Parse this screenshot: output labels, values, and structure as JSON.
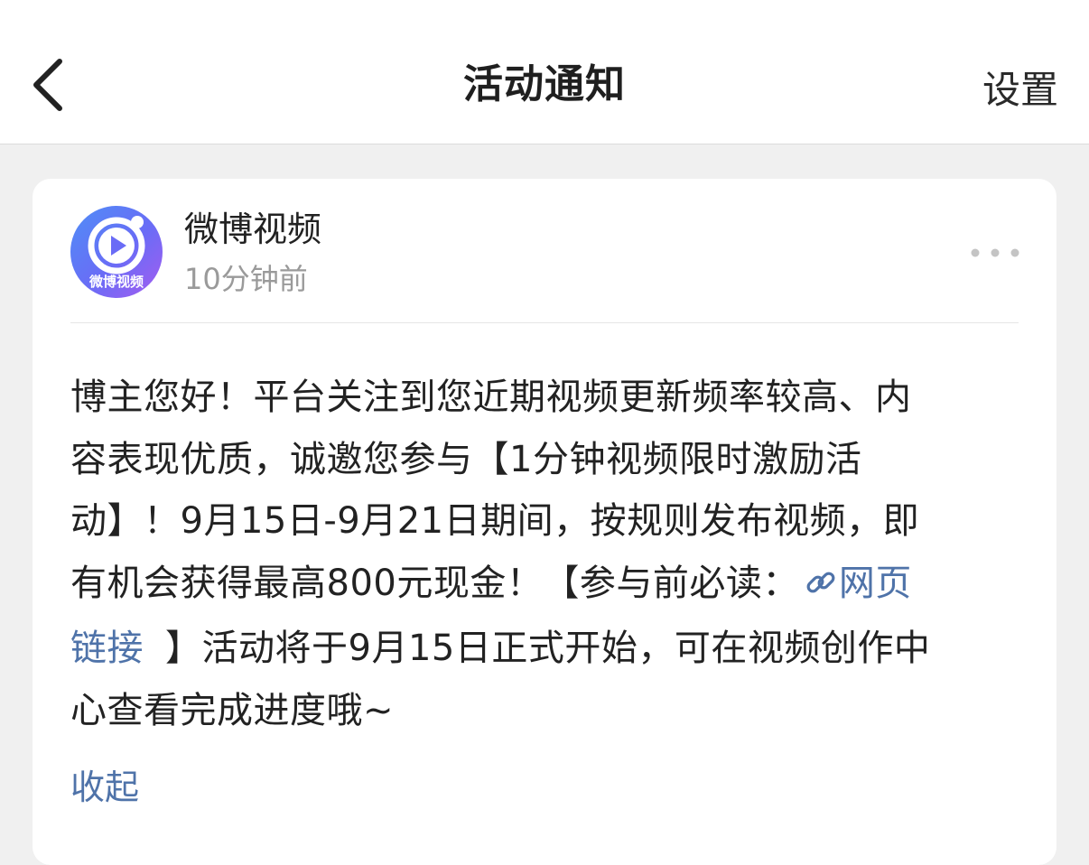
{
  "nav": {
    "title": "活动通知",
    "settings_label": "设置",
    "back_icon": "chevron-left-icon"
  },
  "message": {
    "sender_name": "微博视频",
    "avatar_label": "微博视频",
    "timestamp": "10分钟前",
    "more_icon": "more-dots-icon",
    "lines": [
      {
        "text": "博主您好！平台关注到您近期视频更新频率较高、内"
      },
      {
        "text": "容表现优质，诚邀您参与【1分钟视频限时激励活"
      },
      {
        "text": "动】！9月15日-9月21日期间，按规则发布视频，即"
      },
      {
        "text": "有机会获得最高800元现金！【参与前必读：",
        "link_part": "网页"
      },
      {
        "link_part": "链接",
        "text": "】活动将于9月15日正式开始，可在视频创作中"
      },
      {
        "text": "心查看完成进度哦~"
      }
    ],
    "collapse_label": "收起"
  },
  "colors": {
    "link": "#4f73a9",
    "page_bg": "#f0f0f0",
    "card_bg": "#ffffff",
    "secondary_text": "#9a9a9a"
  }
}
